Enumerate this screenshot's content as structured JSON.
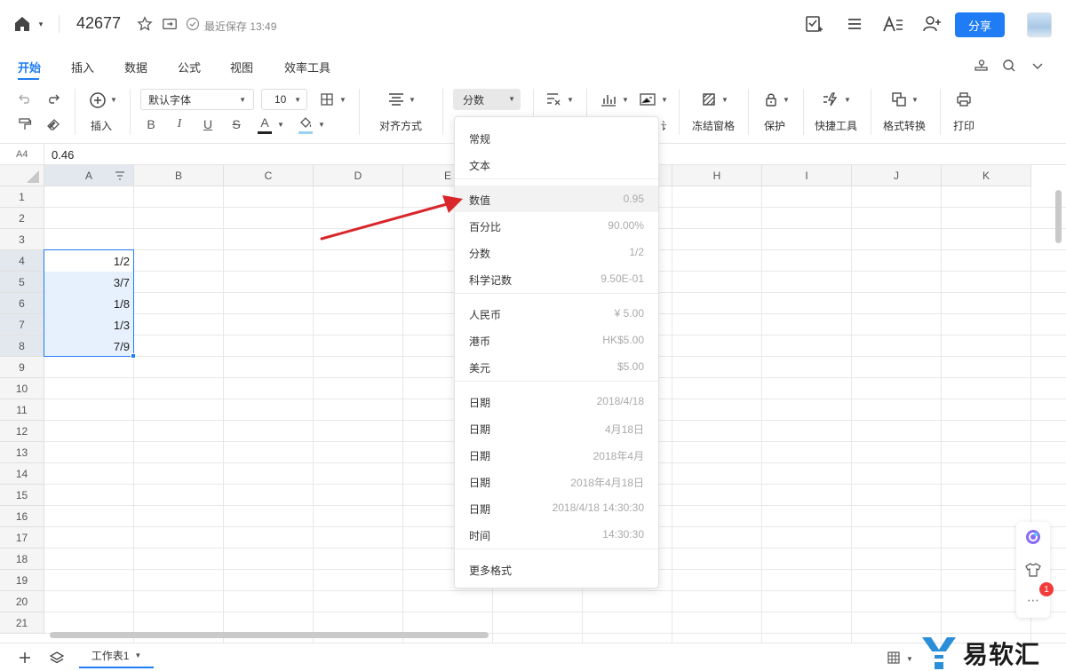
{
  "header": {
    "doc_title": "42677",
    "save_status": "最近保存 13:49",
    "share_label": "分享"
  },
  "tabs": [
    "开始",
    "插入",
    "数据",
    "公式",
    "视图",
    "效率工具"
  ],
  "ribbon": {
    "insert_label": "插入",
    "font_name": "默认字体",
    "font_size": "10",
    "bold": "B",
    "italic": "I",
    "underline": "U",
    "strike": "S",
    "font_color": "A",
    "align_label": "对齐方式",
    "format_value": "分数",
    "freeze_label": "冻结窗格",
    "protect_label": "保护",
    "quick_tools_label": "快捷工具",
    "format_convert_label": "格式转换",
    "print_label": "打印",
    "partial_label": "计"
  },
  "formula_bar": {
    "cell_ref": "A4",
    "value": "0.46"
  },
  "grid": {
    "columns": [
      "A",
      "B",
      "C",
      "D",
      "E",
      "F",
      "G",
      "H",
      "I",
      "J",
      "K"
    ],
    "rows": [
      "1",
      "2",
      "3",
      "4",
      "5",
      "6",
      "7",
      "8",
      "9",
      "10",
      "11",
      "12",
      "13",
      "14",
      "15",
      "16",
      "17",
      "18",
      "19",
      "20",
      "21"
    ],
    "cells": {
      "4": "1/2",
      "5": "3/7",
      "6": "1/8",
      "7": "1/3",
      "8": "7/9"
    }
  },
  "format_menu": {
    "items": [
      {
        "label": "常规",
        "example": ""
      },
      {
        "label": "文本",
        "example": ""
      },
      {
        "label": "数值",
        "example": "0.95"
      },
      {
        "label": "百分比",
        "example": "90.00%"
      },
      {
        "label": "分数",
        "example": "1/2"
      },
      {
        "label": "科学记数",
        "example": "9.50E-01"
      },
      {
        "label": "人民币",
        "example": "¥ 5.00"
      },
      {
        "label": "港币",
        "example": "HK$5.00"
      },
      {
        "label": "美元",
        "example": "$5.00"
      },
      {
        "label": "日期",
        "example": "2018/4/18"
      },
      {
        "label": "日期",
        "example": "4月18日"
      },
      {
        "label": "日期",
        "example": "2018年4月"
      },
      {
        "label": "日期",
        "example": "2018年4月18日"
      },
      {
        "label": "日期",
        "example": "2018/4/18 14:30:30"
      },
      {
        "label": "时间",
        "example": "14:30:30"
      },
      {
        "label": "更多格式",
        "example": ""
      }
    ]
  },
  "bottom": {
    "sheet_name": "工作表1",
    "notification_count": "1",
    "watermark": "易软汇"
  },
  "colors": {
    "accent": "#1f7cf4",
    "selection_fill": "#e6f1fd",
    "arrow": "#d9262b"
  }
}
